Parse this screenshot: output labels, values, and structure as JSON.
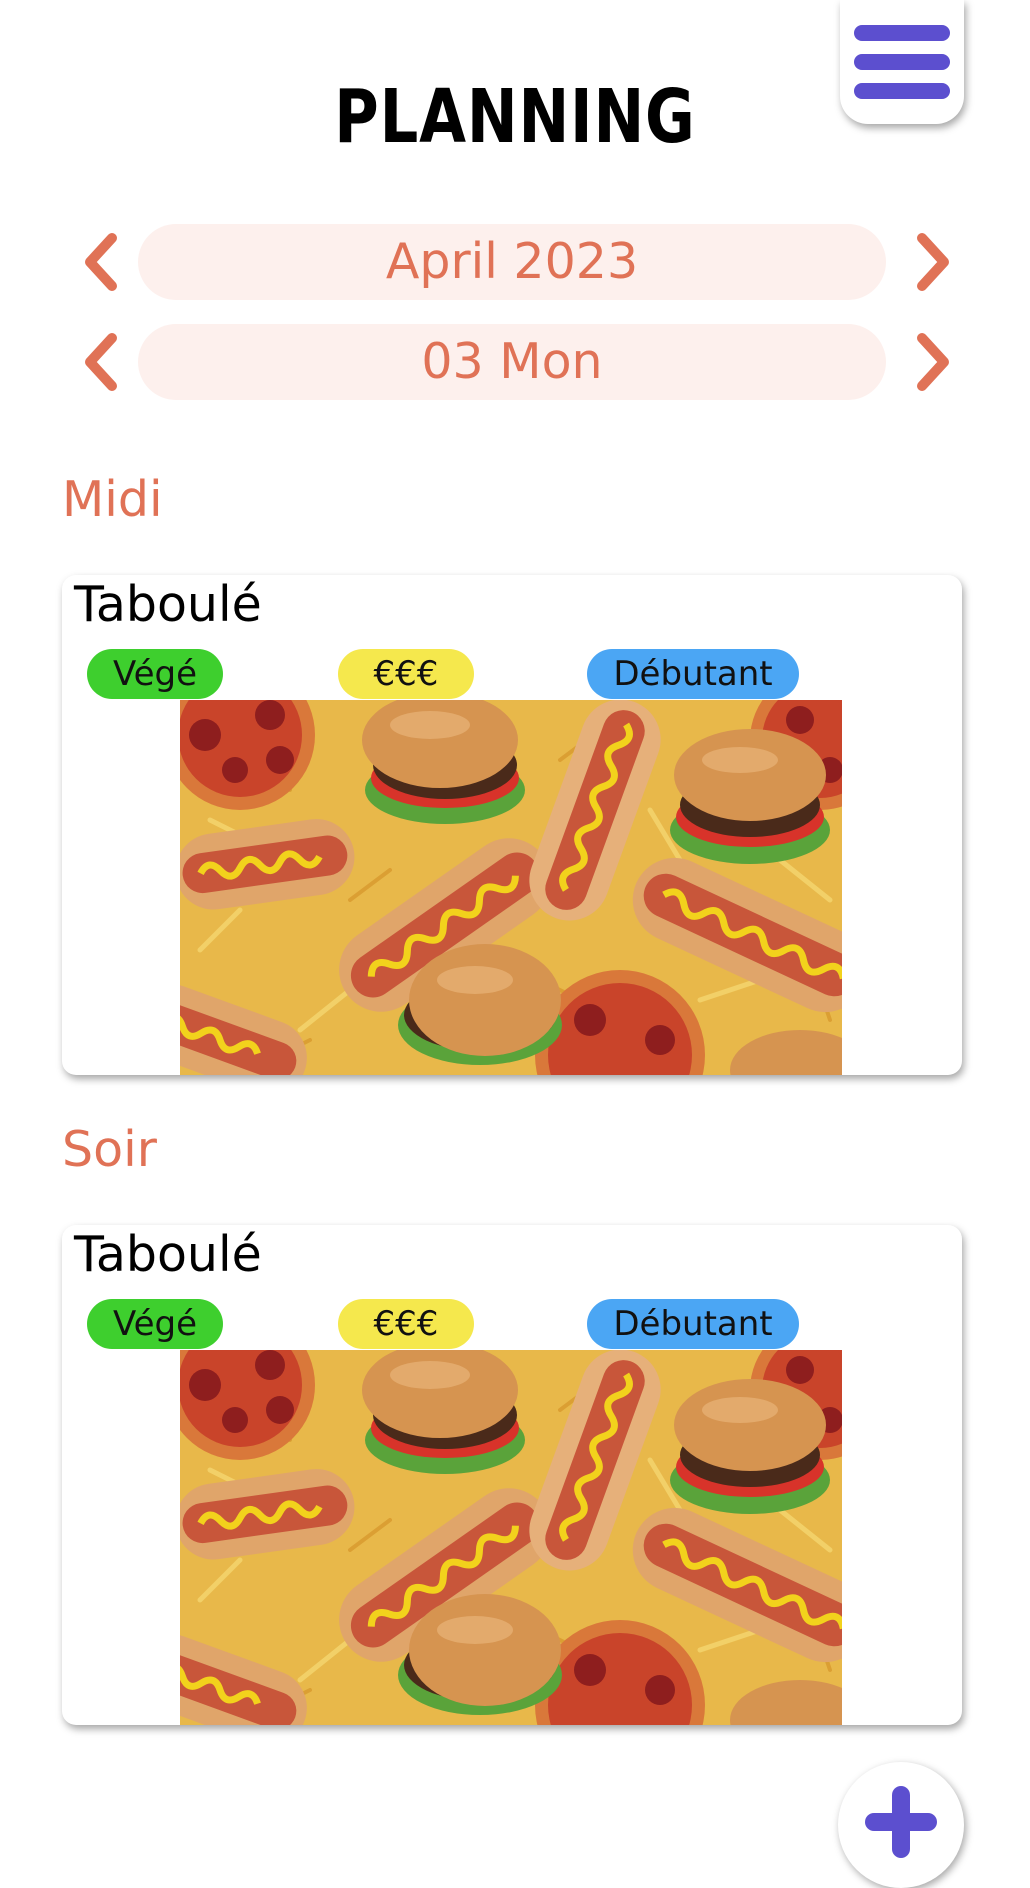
{
  "header": {
    "title": "PLANNING",
    "menu_icon": "hamburger-menu-icon"
  },
  "month_nav": {
    "value": "April 2023",
    "prev_icon": "chevron-left-icon",
    "next_icon": "chevron-right-icon"
  },
  "day_nav": {
    "value": "03 Mon",
    "prev_icon": "chevron-left-icon",
    "next_icon": "chevron-right-icon"
  },
  "meals": [
    {
      "section": "Midi",
      "title": "Taboulé",
      "tags": {
        "diet": "Végé",
        "price": "€€€",
        "level": "Débutant"
      },
      "image": "fast-food-photo"
    },
    {
      "section": "Soir",
      "title": "Taboulé",
      "tags": {
        "diet": "Végé",
        "price": "€€€",
        "level": "Débutant"
      },
      "image": "fast-food-photo"
    }
  ],
  "fab": {
    "icon": "plus-icon"
  },
  "colors": {
    "accent": "#e07256",
    "pill_bg": "#fdf0ed",
    "brand_purple": "#5c4fcf",
    "tag_diet": "#3ecf2e",
    "tag_price": "#f5e84d",
    "tag_level": "#4ba6f4"
  }
}
